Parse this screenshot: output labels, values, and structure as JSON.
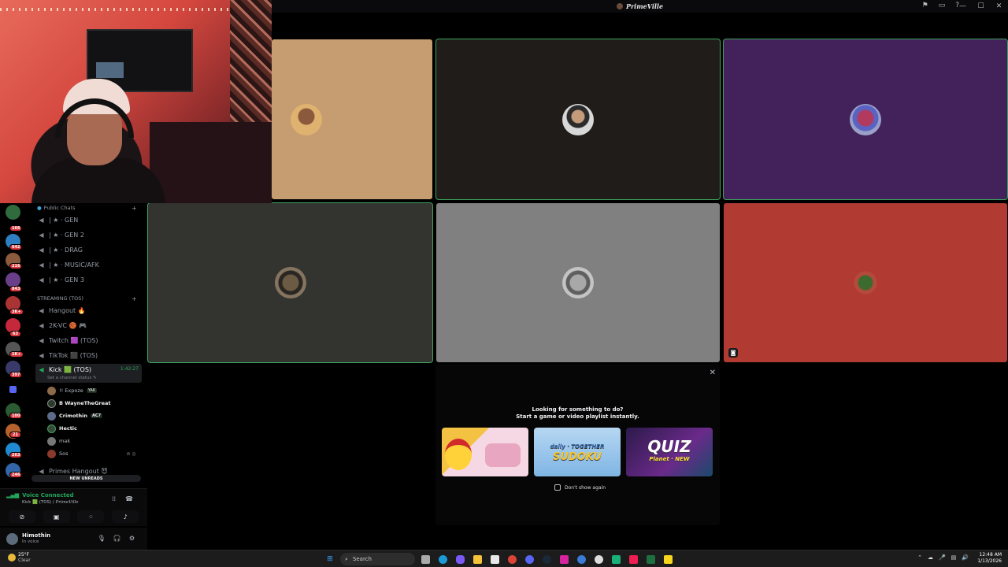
{
  "window": {
    "title": "PrimeVille",
    "controls": [
      "—",
      "☐",
      "✕"
    ],
    "top_icons": [
      "⚑",
      "▭",
      "?"
    ]
  },
  "server_rail": {
    "badges": [
      "166",
      "642",
      "216",
      "843",
      "3K+",
      "63",
      "1K+",
      "397",
      "100",
      "21",
      "263",
      "246"
    ]
  },
  "channels": {
    "category_public": "Public Chats",
    "public_channels": [
      "| ★ · GEN",
      "| ★ · GEN 2",
      "| ★ · DRAG",
      "| ★ · MUSIC/AFK",
      "| ★ · GEN 3"
    ],
    "category_streaming": "STREAMING (TOS)",
    "streaming_channels": [
      "Hangout 🔥",
      "2K-VC 🏀 🎮",
      "Twitch 🟪 (TOS)",
      "TikTok ⬛ (TOS)"
    ],
    "active_channel": {
      "name": "Kick 🟩 (TOS)",
      "timer": "1:42:27",
      "status_hint": "Set a channel status ✎"
    },
    "voice_users": [
      {
        "name": "!! Expoze",
        "tag": "YAK",
        "bold": false
      },
      {
        "name": "B WayneTheGreat",
        "tag": "",
        "bold": true
      },
      {
        "name": "Crimothin",
        "tag": "AC7",
        "bold": true
      },
      {
        "name": "Hectic",
        "tag": "",
        "bold": true
      },
      {
        "name": "mak",
        "tag": "",
        "bold": false
      },
      {
        "name": "Sos",
        "tag": "",
        "bold": false
      }
    ],
    "last_channel": "Primes Hangout 😈",
    "new_unreads": "NEW UNREADS"
  },
  "voice_panel": {
    "status": "Voice Connected",
    "location_prefix": "Kick 🟩 (TOS) / ",
    "location_server": "PrimeVille"
  },
  "user_panel": {
    "name": "Himothin",
    "status": "In voice"
  },
  "activity_popup": {
    "line1": "Looking for something to do?",
    "line2": "Start a game or video playlist instantly.",
    "games": [
      {
        "title": "",
        "subtitle": ""
      },
      {
        "title": "SUDOKU",
        "subtitle": "daily · TOGETHER"
      },
      {
        "title": "QUIZ",
        "subtitle": "Planet · NEW"
      }
    ],
    "dont_show": "Don't show again"
  },
  "taskbar": {
    "temp": "25°F",
    "condition": "Clear",
    "search_placeholder": "Search",
    "time": "12:48 AM",
    "date": "1/13/2026"
  },
  "colors": {
    "speaking_outline": "#3ba55c",
    "voice_green": "#23a55a",
    "badge_red": "#da373c"
  }
}
